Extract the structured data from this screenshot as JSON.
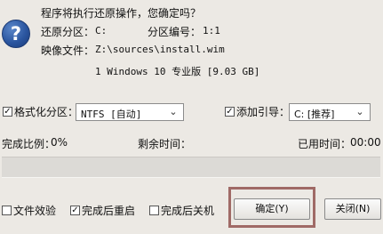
{
  "prompt": {
    "question": "程序将执行还原操作，您确定吗？"
  },
  "info": {
    "restore_partition_label": "还原分区：",
    "restore_partition_value": "C:",
    "partition_number_label": "分区编号：",
    "partition_number_value": "1:1",
    "image_file_label": "映像文件：",
    "image_file_value": "Z:\\sources\\install.wim",
    "image_entry": "1 Windows 10 专业版 [9.03 GB]"
  },
  "options": {
    "format_label": "格式化分区：",
    "format_checked": true,
    "format_value": "NTFS [自动]",
    "boot_label": "添加引导：",
    "boot_checked": true,
    "boot_value": "C: [推荐]"
  },
  "progress": {
    "complete_label": "完成比例：",
    "complete_value": "0%",
    "remaining_label": "剩余时间：",
    "remaining_value": "",
    "elapsed_label": "已用时间：",
    "elapsed_value": "00:00",
    "fraction": 0
  },
  "footer": {
    "verify_label": "文件效验",
    "verify_checked": false,
    "reboot_label": "完成后重启",
    "reboot_checked": true,
    "shutdown_label": "完成后关机",
    "shutdown_checked": false,
    "ok_label": "确定(Y)",
    "close_label": "关闭(N)"
  },
  "colors": {
    "progress_fill": "#3a8ee6",
    "highlight_box": "#a06a66"
  },
  "icons": {
    "prompt_icon": "question-mark-icon",
    "dropdown_icon": "chevron-down-icon",
    "check_icon": "check-icon"
  }
}
